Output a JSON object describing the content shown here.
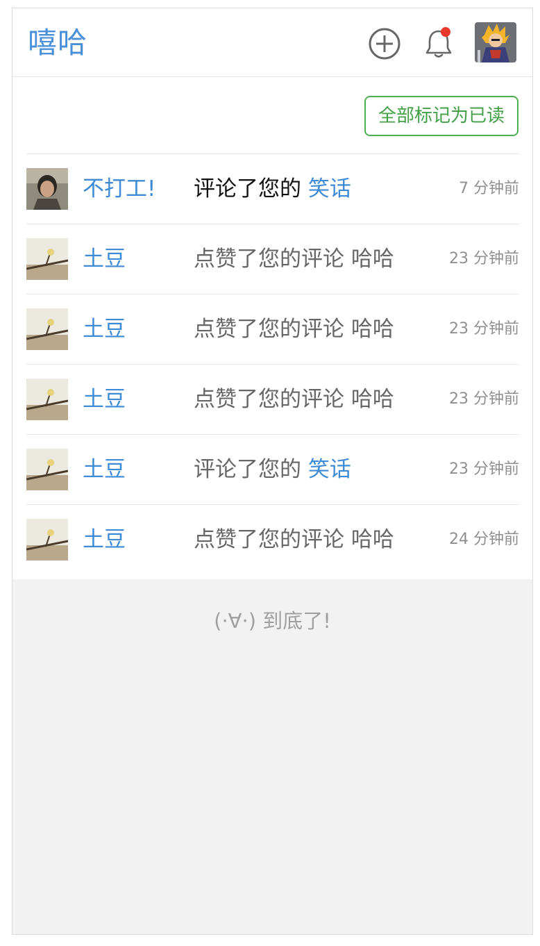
{
  "header": {
    "brand": "嘻哈",
    "add_icon": "plus-circle-icon",
    "bell_icon": "bell-icon",
    "bell_has_badge": true,
    "badge_color": "#e8392c",
    "avatar": "user-avatar"
  },
  "toolbar": {
    "mark_all_label": "全部标记为已读"
  },
  "notifications": [
    {
      "user": "不打工!",
      "action": "评论了您的",
      "target": "笑话",
      "time": "7 分钟前",
      "unread": true
    },
    {
      "user": "土豆",
      "action": "点赞了您的评论",
      "target": "哈哈",
      "time": "23 分钟前",
      "unread": false
    },
    {
      "user": "土豆",
      "action": "点赞了您的评论",
      "target": "哈哈",
      "time": "23 分钟前",
      "unread": false
    },
    {
      "user": "土豆",
      "action": "点赞了您的评论",
      "target": "哈哈",
      "time": "23 分钟前",
      "unread": false
    },
    {
      "user": "土豆",
      "action": "评论了您的",
      "target": "笑话",
      "time": "23 分钟前",
      "unread": false
    },
    {
      "user": "土豆",
      "action": "点赞了您的评论",
      "target": "哈哈",
      "time": "24 分钟前",
      "unread": false
    }
  ],
  "footer": {
    "end_text": "(·∀·) 到底了!"
  },
  "colors": {
    "brand": "#4a90d9",
    "link": "#3d8ad6",
    "mark_all_border": "#4caf50",
    "background": "#f2f2f2"
  }
}
